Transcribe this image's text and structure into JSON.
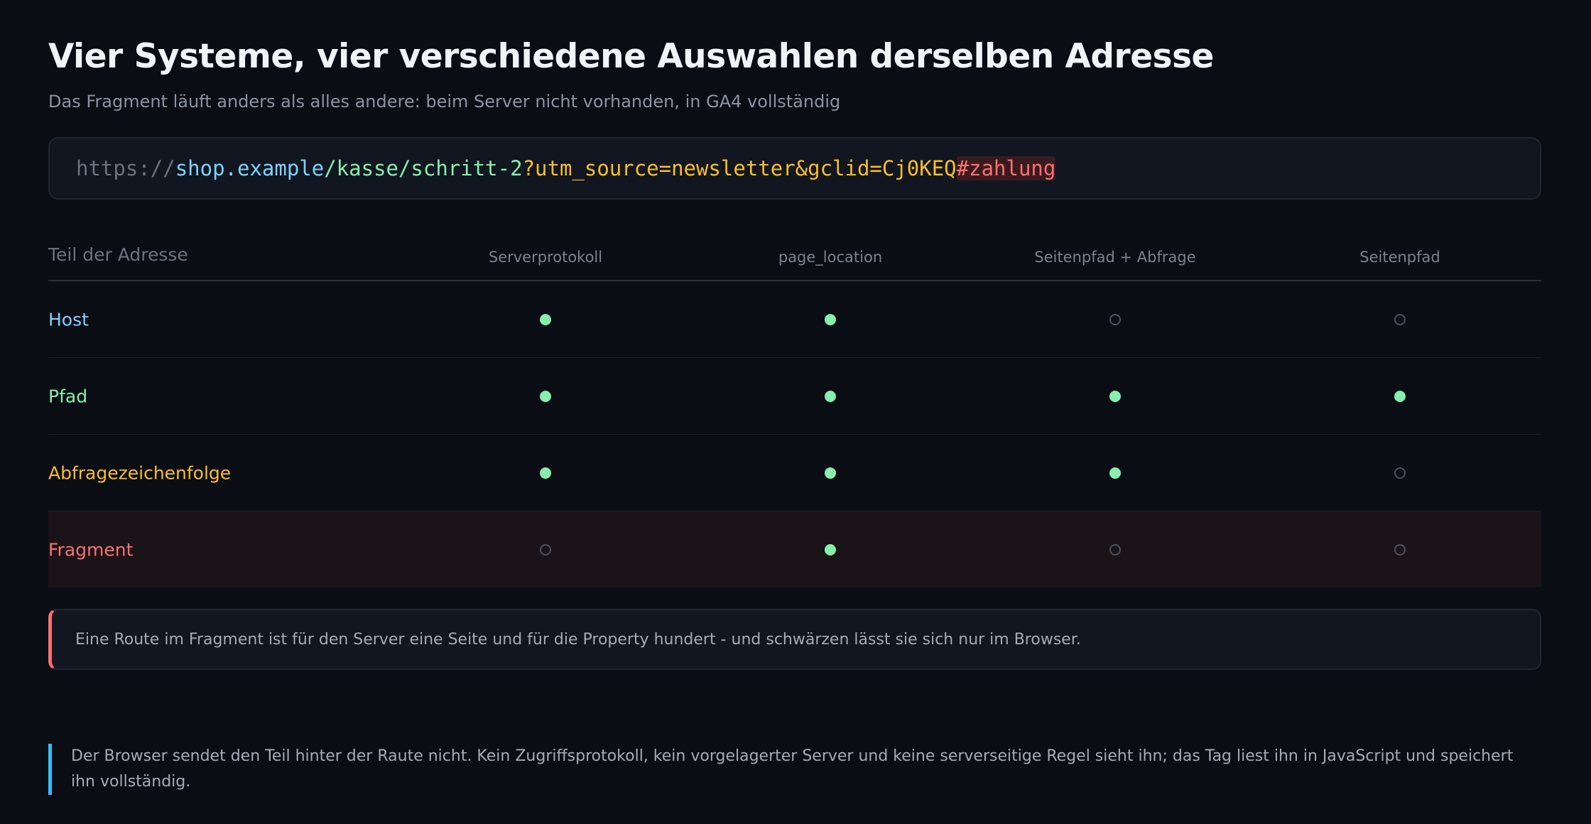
{
  "heading": {
    "title": "Vier Systeme, vier verschiedene Auswahlen derselben Adresse",
    "subtitle": "Das Fragment läuft anders als alles andere: beim Server nicht vorhanden, in GA4 vollständig"
  },
  "url": {
    "scheme": "https://",
    "host": "shop.example",
    "path": "/kasse/schritt-2",
    "query": "?utm_source=newsletter&gclid=Cj0KEQ",
    "fragment": "#zahlung"
  },
  "table": {
    "first_header": "Teil der Adresse",
    "columns": [
      "Serverprotokoll",
      "page_location",
      "Seitenpfad + Abfrage",
      "Seitenpfad"
    ],
    "rows": [
      {
        "label": "Host",
        "color": "#7dd3fc",
        "values": [
          true,
          true,
          false,
          false
        ],
        "highlight": false
      },
      {
        "label": "Pfad",
        "color": "#86efac",
        "values": [
          true,
          true,
          true,
          true
        ],
        "highlight": false
      },
      {
        "label": "Abfragezeichenfolge",
        "color": "#fbbf24",
        "values": [
          true,
          true,
          true,
          false
        ],
        "highlight": false
      },
      {
        "label": "Fragment",
        "color": "#f87171",
        "values": [
          false,
          true,
          false,
          false
        ],
        "highlight": true
      }
    ]
  },
  "callout": {
    "text": "Eine Route im Fragment ist für den Server eine Seite und für die Property hundert - und schwärzen lässt sie sich nur im Browser."
  },
  "note": {
    "text": "Der Browser sendet den Teil hinter der Raute nicht. Kein Zugriffsprotokoll, kein vorgelagerter Server und keine serverseitige Regel sieht ihn; das Tag liest ihn in JavaScript und speichert ihn vollständig."
  }
}
